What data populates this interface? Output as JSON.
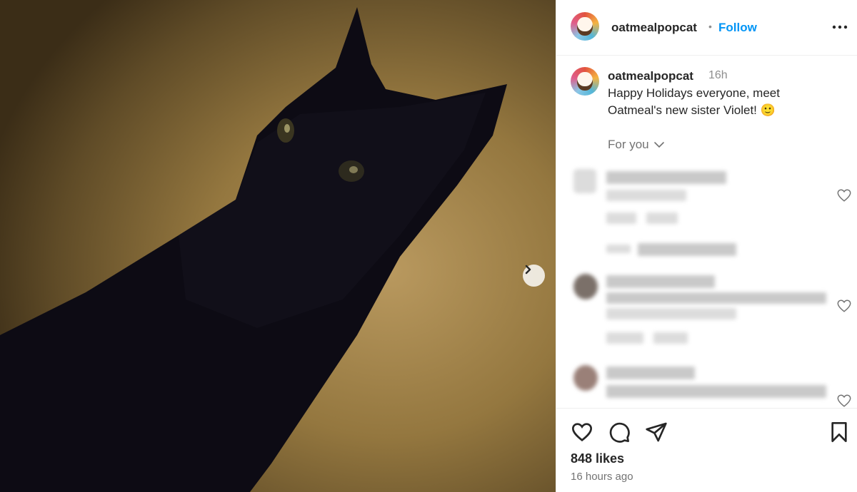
{
  "post": {
    "username": "oatmealpopcat",
    "follow_label": "Follow",
    "separator": "•"
  },
  "caption": {
    "username": "oatmealpopcat",
    "time": "16h",
    "text": "Happy Holidays everyone, meet Oatmeal's new sister Violet! 🙂"
  },
  "comments_filter": {
    "label": "For you"
  },
  "stats": {
    "likes": "848 likes",
    "posted": "16 hours ago"
  },
  "icons": {
    "next": "chevron-right-icon",
    "more": "more-horizontal-icon",
    "like": "heart-icon",
    "comment": "comment-icon",
    "share": "paper-plane-icon",
    "save": "bookmark-icon"
  },
  "colors": {
    "accent": "#0095f6",
    "text": "#262626",
    "secondary": "#737373"
  }
}
